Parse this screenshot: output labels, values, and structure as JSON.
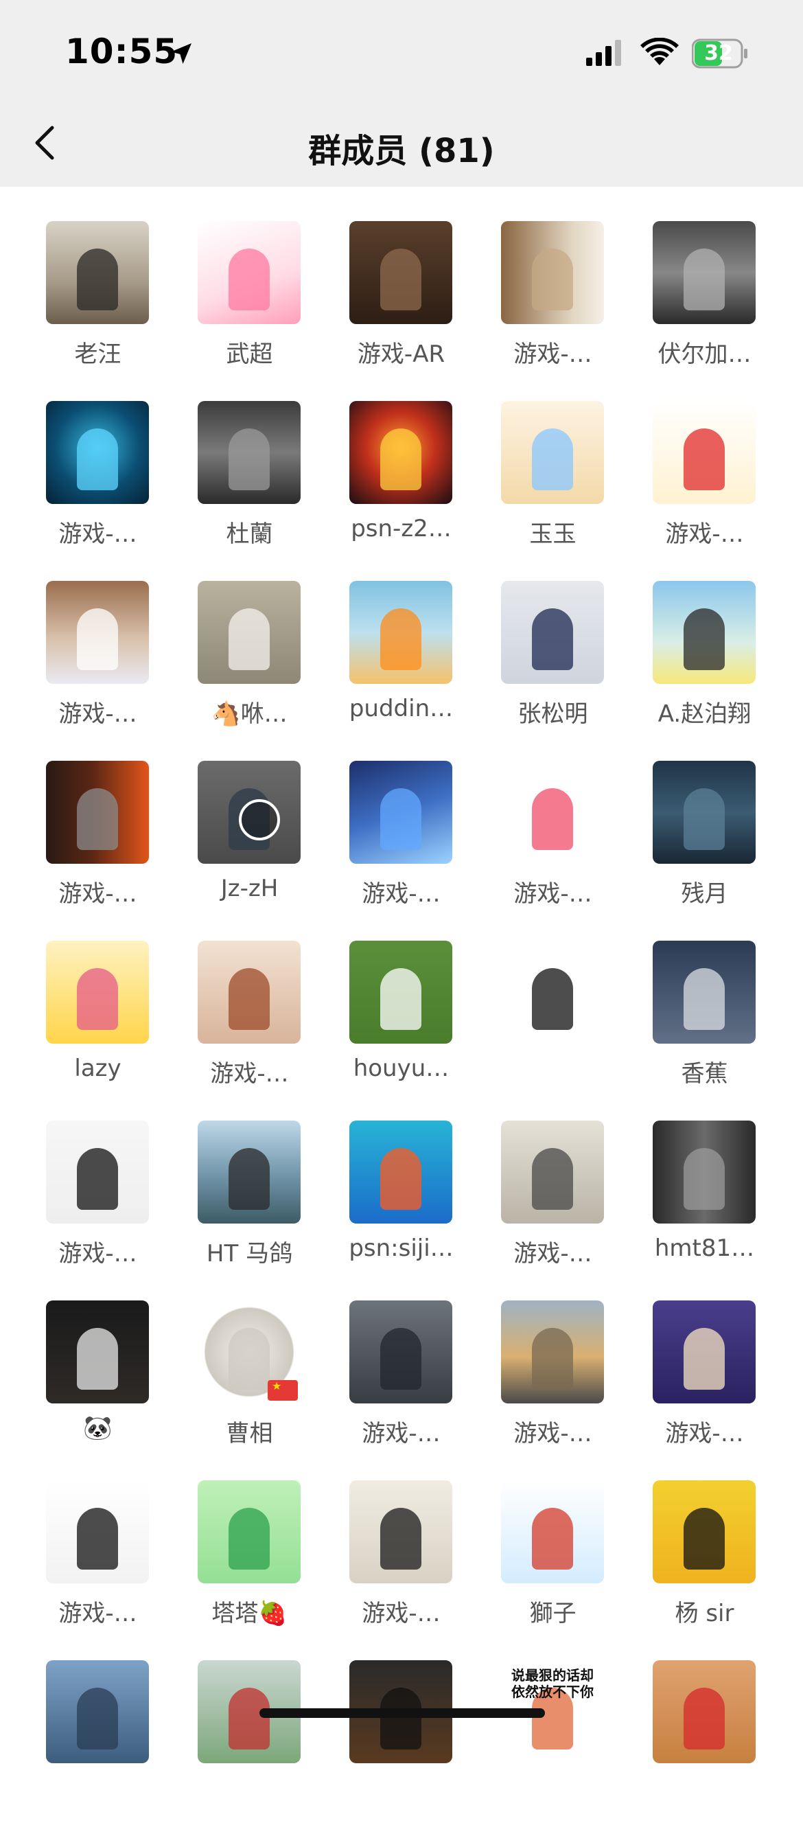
{
  "status": {
    "time": "10:55",
    "battery": "32"
  },
  "header": {
    "title": "群成员 (81)"
  },
  "members": [
    {
      "name": "老汪",
      "bg": "linear-gradient(180deg,#d8d2c6 0%,#a69a88 60%,#6b5e4d 100%)",
      "accent": "#2b2926"
    },
    {
      "name": "武超",
      "bg": "linear-gradient(160deg,#ffffff 0%,#ffdce6 60%,#ff9fba 100%)",
      "accent": "#ff7aa2"
    },
    {
      "name": "游戏-AR",
      "bg": "linear-gradient(180deg,#5a3f2c 0%,#2d1e14 100%)",
      "accent": "#8c6a4c"
    },
    {
      "name": "游戏-…",
      "bg": "linear-gradient(90deg,#8a6540 0%,#e3d7c3 70%,#f5efe6 100%)",
      "accent": "#c6a985"
    },
    {
      "name": "伏尔加…",
      "bg": "linear-gradient(180deg,#4a4a4a 0%,#888888 50%,#2a2a2a 100%)",
      "accent": "#b0b0b0"
    },
    {
      "name": "游戏-…",
      "bg": "radial-gradient(circle at 50% 45%,#37b7d9 0%,#0b4e73 55%,#052236 100%)",
      "accent": "#5ed6ff"
    },
    {
      "name": "杜蘭",
      "bg": "linear-gradient(180deg,#3c3c3c 0%,#7a7a7a 50%,#2a2a2a 100%)",
      "accent": "#999999"
    },
    {
      "name": "psn-z2…",
      "bg": "radial-gradient(circle at 50% 45%,#ff9d2f 0%,#c1301c 45%,#1a0d12 100%)",
      "accent": "#ffcf3f"
    },
    {
      "name": "玉玉",
      "bg": "linear-gradient(180deg,#fdf3e3 0%,#f3d9a8 100%)",
      "accent": "#89c7ff"
    },
    {
      "name": "游戏-…",
      "bg": "linear-gradient(180deg,#ffffff 0%,#fff2d1 100%)",
      "accent": "#e02b2b"
    },
    {
      "name": "游戏-…",
      "bg": "linear-gradient(180deg,#9a6d4d 0%,#d8c0aa 55%,#eaeaf2 100%)",
      "accent": "#ffffff"
    },
    {
      "name": "🐴咻…",
      "bg": "linear-gradient(180deg,#b8b29e 0%,#8e8777 100%)",
      "accent": "#f4f2ed"
    },
    {
      "name": "puddin…",
      "bg": "linear-gradient(180deg,#7fc2e0 0%,#bde0ef 50%,#f5c26b 100%)",
      "accent": "#ff8c1a"
    },
    {
      "name": "张松明",
      "bg": "linear-gradient(180deg,#e6e8ec 0%,#cfd4de 100%)",
      "accent": "#1f2a52"
    },
    {
      "name": "A.赵泊翔",
      "bg": "linear-gradient(180deg,#8cc7ec 0%,#d9efe6 60%,#f8e87a 100%)",
      "accent": "#2a2a2a"
    },
    {
      "name": "游戏-…",
      "bg": "linear-gradient(90deg,#2a1a14 0%,#5a2614 45%,#e1551a 100%)",
      "accent": "#8b8b8b"
    },
    {
      "name": "Jz-zH",
      "bg": "linear-gradient(180deg,#6b6b6b 0%,#4a4a4a 100%)",
      "accent": "#2e3b4a",
      "play": true
    },
    {
      "name": "游戏-…",
      "bg": "linear-gradient(160deg,#1d2f6b 0%,#3e6fc4 50%,#9bd2ff 100%)",
      "accent": "#62a8ff"
    },
    {
      "name": "游戏-…",
      "bg": "linear-gradient(180deg,#ffffff 0%,#ffffff 100%)",
      "accent": "#f04d6b"
    },
    {
      "name": "残月",
      "bg": "linear-gradient(180deg,#203448 0%,#3b5c72 50%,#192735 100%)",
      "accent": "#5b7f95"
    },
    {
      "name": "lazy",
      "bg": "linear-gradient(180deg,#fff2c2 0%,#ffd54a 100%)",
      "accent": "#e55b8a"
    },
    {
      "name": "游戏-…",
      "bg": "linear-gradient(180deg,#f2e2d2 0%,#d8b49a 100%)",
      "accent": "#9d4c2b"
    },
    {
      "name": "houyu…",
      "bg": "linear-gradient(180deg,#5b8f3a 0%,#4a7d2b 100%)",
      "accent": "#ffffff"
    },
    {
      "name": "",
      "bg": "linear-gradient(180deg,#ffffff 0%,#ffffff 100%)",
      "accent": "#111111"
    },
    {
      "name": "香蕉",
      "bg": "linear-gradient(180deg,#2b3b54 0%,#617087 100%)",
      "accent": "#d9dde3"
    },
    {
      "name": "游戏-…",
      "bg": "linear-gradient(180deg,#f7f7f7 0%,#eeeeee 100%)",
      "accent": "#111111"
    },
    {
      "name": "HT 马鸽",
      "bg": "linear-gradient(180deg,#bfd8ea 0%,#6f93a7 55%,#3e5b66 100%)",
      "accent": "#2a2a2a"
    },
    {
      "name": "psn:siji…",
      "bg": "linear-gradient(180deg,#28b4d6 0%,#1b6cc9 100%)",
      "accent": "#ff5a1f"
    },
    {
      "name": "游戏-…",
      "bg": "linear-gradient(180deg,#e4e1d7 0%,#b9b4a6 100%)",
      "accent": "#4a4a4a"
    },
    {
      "name": "hmt81…",
      "bg": "linear-gradient(90deg,#2a2a2a 0%,#6a6a6a 50%,#2a2a2a 100%)",
      "accent": "#9a9a9a"
    },
    {
      "name": "🐼",
      "bg": "linear-gradient(180deg,#1a1a1a 0%,#2e2a28 100%)",
      "accent": "#e8e8e8"
    },
    {
      "name": "曹相",
      "bg": "radial-gradient(circle at 50% 50%,#f1efe9 0%,#cfcac0 60%,#ffffff 62%,#ffffff 100%)",
      "accent": "#cfcac0",
      "flag": true
    },
    {
      "name": "游戏-…",
      "bg": "linear-gradient(180deg,#6d737b 0%,#383d44 100%)",
      "accent": "#22272d"
    },
    {
      "name": "游戏-…",
      "bg": "linear-gradient(180deg,#9fb3c4 0%,#d9b070 55%,#4a4a4a 100%)",
      "accent": "#7a6a52"
    },
    {
      "name": "游戏-…",
      "bg": "linear-gradient(180deg,#4a3e8c 0%,#2a2260 100%)",
      "accent": "#f5e3c2"
    },
    {
      "name": "游戏-…",
      "bg": "linear-gradient(180deg,#ffffff 0%,#f2f2f2 100%)",
      "accent": "#111111"
    },
    {
      "name": "塔塔🍓",
      "bg": "linear-gradient(180deg,#bff0b8 0%,#95df95 100%)",
      "accent": "#2ca24e"
    },
    {
      "name": "游戏-…",
      "bg": "linear-gradient(180deg,#f0ece2 0%,#d8d2c4 100%)",
      "accent": "#1a1a1a"
    },
    {
      "name": "獅子",
      "bg": "linear-gradient(180deg,#ffffff 0%,#d4ecff 100%)",
      "accent": "#d43b2a"
    },
    {
      "name": "杨 sir",
      "bg": "linear-gradient(180deg,#f2d02f 0%,#f0b21f 100%)",
      "accent": "#111111"
    },
    {
      "name": "",
      "bg": "linear-gradient(180deg,#7ea2c7 0%,#3d5d7d 100%)",
      "accent": "#2a3e55"
    },
    {
      "name": "",
      "bg": "linear-gradient(180deg,#c9d7d2 0%,#7da77a 100%)",
      "accent": "#c22f2f"
    },
    {
      "name": "",
      "bg": "linear-gradient(180deg,#2a2a2a 0%,#5a3a20 100%)",
      "accent": "#111111"
    },
    {
      "name": "",
      "bg": "linear-gradient(180deg,#ffffff 0%,#ffffff 100%)",
      "accent": "#e0683a",
      "caption": "说最狠的话却依然放不下你"
    },
    {
      "name": "",
      "bg": "linear-gradient(180deg,#e0a270 0%,#c7803f 100%)",
      "accent": "#d42a2a"
    }
  ]
}
